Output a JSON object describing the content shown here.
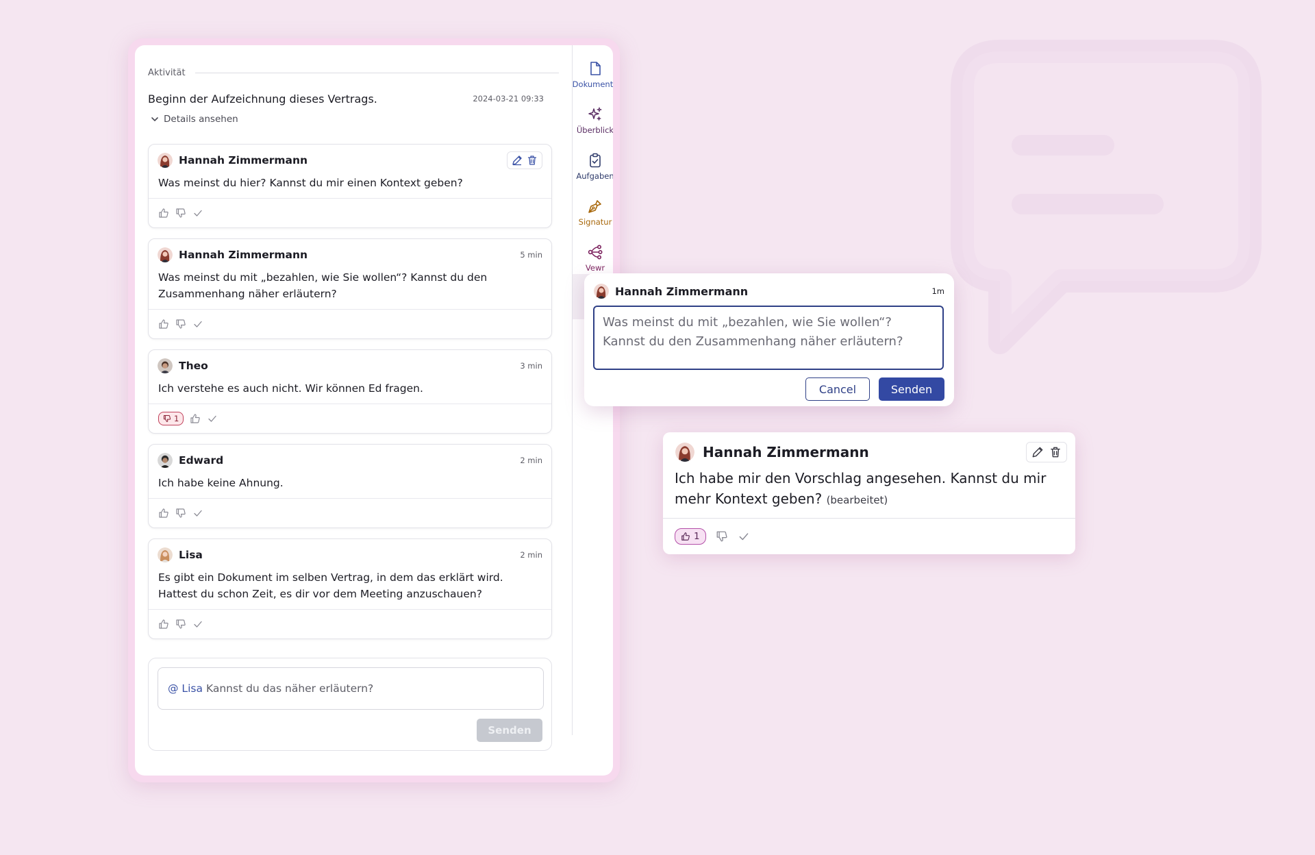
{
  "colors": {
    "background": "#f5e6f1",
    "accent": "#3349a3",
    "rail_documents": "#3a52a6",
    "rail_overview": "#5a2d63",
    "rail_tasks": "#2f3b6b",
    "rail_signature": "#a8680c",
    "rail_vewr": "#7a1f5c",
    "dislike_badge": "#c0405a",
    "like_badge": "#b34fa8"
  },
  "activity": {
    "header": "Aktivität",
    "record_text": "Beginn der Aufzeichnung dieses Vertrags.",
    "record_time": "2024-03-21 09:33",
    "details_label": "Details ansehen",
    "details_icon": "chevron-down-icon"
  },
  "comments": [
    {
      "author": "Hannah Zimmermann",
      "time": "",
      "text": "Was meinst du hier? Kannst du mir einen Kontext geben?",
      "show_edit": true
    },
    {
      "author": "Hannah Zimmermann",
      "time": "5 min",
      "text": "Was meinst du mit „bezahlen, wie Sie wollen“? Kannst du den Zusammenhang näher erläutern?"
    },
    {
      "author": "Theo",
      "time": "3 min",
      "text": "Ich verstehe es auch nicht. Wir können Ed fragen.",
      "dislike_count": "1"
    },
    {
      "author": "Edward",
      "time": "2 min",
      "text": "Ich habe keine Ahnung."
    },
    {
      "author": "Lisa",
      "time": "2 min",
      "text": "Es gibt ein Dokument im selben Vertrag, in dem das erklärt wird. Hattest du schon Zeit, es dir vor dem Meeting anzuschauen?"
    }
  ],
  "composer": {
    "mention": "@ Lisa",
    "text": "Kannst du das näher erläutern?",
    "send_label": "Senden"
  },
  "rail": [
    {
      "label": "Dokumente",
      "icon": "document-icon"
    },
    {
      "label": "Überblick",
      "icon": "sparkles-icon"
    },
    {
      "label": "Aufgaben",
      "icon": "clipboard-check-icon"
    },
    {
      "label": "Signatur",
      "icon": "pen-nib-icon"
    },
    {
      "label": "Vewr",
      "icon": "share-nodes-icon"
    }
  ],
  "popup": {
    "author": "Hannah Zimmermann",
    "time": "1m",
    "text": "Was meinst du mit „bezahlen, wie Sie wollen“? Kannst du den Zusammenhang näher erläutern?",
    "cancel_label": "Cancel",
    "send_label": "Senden"
  },
  "edited_card": {
    "author": "Hannah Zimmermann",
    "text": "Ich habe mir den Vorschlag angesehen. Kannst du mir mehr Kontext geben?",
    "edited_label": "(bearbeitet)",
    "like_count": "1"
  }
}
